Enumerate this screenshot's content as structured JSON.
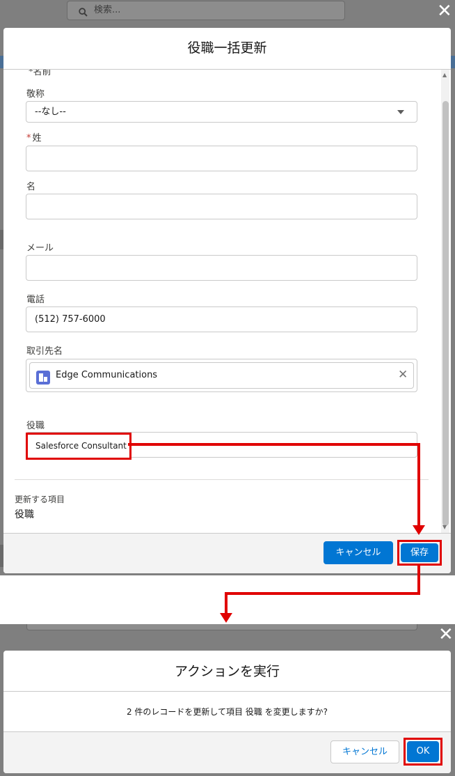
{
  "screen1": {
    "search_placeholder": "検索...",
    "modal_title": "役職一括更新",
    "cut_label": "*名前",
    "fields": {
      "salutation_label": "敬称",
      "salutation_value": "--なし--",
      "lastname_label": "姓",
      "required_mark": "*",
      "firstname_label": "名",
      "email_label": "メール",
      "phone_label": "電話",
      "phone_value": "(512) 757-6000",
      "account_label": "取引先名",
      "account_value": "Edge Communications",
      "title_label": "役職",
      "title_value": "Salesforce Consultant"
    },
    "update_items_label": "更新する項目",
    "update_items_value": "役職",
    "cancel_label": "キャンセル",
    "save_label": "保存"
  },
  "screen2": {
    "modal_title": "アクションを実行",
    "message": "2 件のレコードを更新して項目 役職 を変更しますか?",
    "cancel_label": "キャンセル",
    "ok_label": "OK"
  },
  "colors": {
    "brand": "#0176d3",
    "highlight": "#e00000",
    "overlay": "#7f7f7f"
  },
  "icons": [
    "search-icon",
    "close-icon",
    "chevron-down-icon",
    "account-icon",
    "clear-icon"
  ]
}
